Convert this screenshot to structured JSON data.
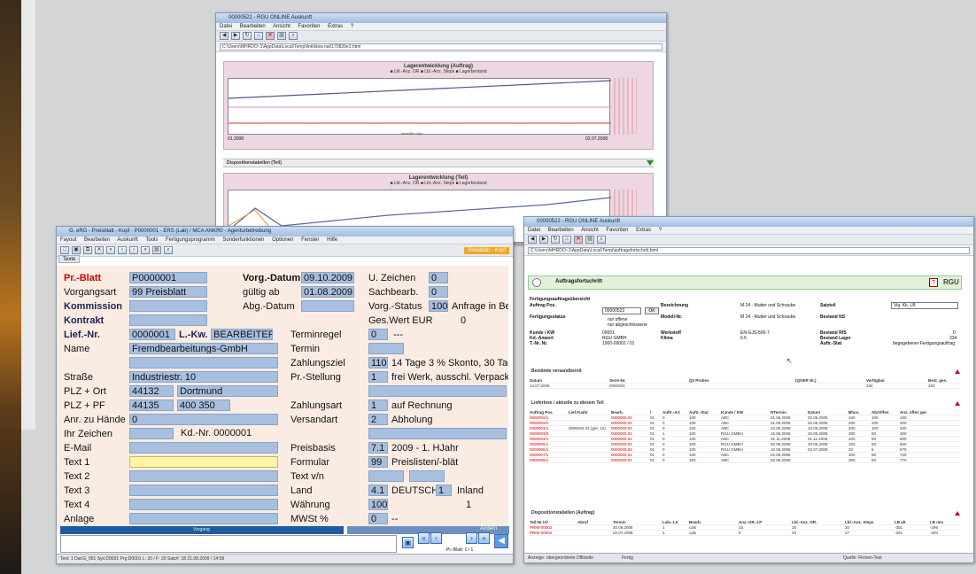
{
  "win1": {
    "title": "00000522 - RGU ONLINE Auskunft",
    "menu": [
      "Datei",
      "Bearbeiten",
      "Ansicht",
      "Favoriten",
      "Extras",
      "?"
    ],
    "address": "C:\\Users\\MHRDO~1\\AppData\\Local\\Temp\\link\\ktow.na0170839e2.html",
    "chart1": {
      "title": "Lagerentwicklung (Auftrag)",
      "legend": "■ Lbl.-Anz. OR   ■ Lbl.-Anz. Steps   ■ Lagerbestand",
      "x_start": "01.2008",
      "x_end": "02.07.2008",
      "x_mid": "erstelllt+ clips"
    },
    "section": "Dispositionstabellen (Teil)",
    "chart2": {
      "title": "Lagerentwicklung (Teil)",
      "legend": "■ Lbl.-Anz. OR   ■ Lbl.-Anz. Steps   ■ Lagerbestand"
    }
  },
  "win3": {
    "title": "G. eRG - Preisblatt - Kopf - P0000001 - ERS (Lab) / MCA ANKR0 - Agenturbetreibung",
    "menu": [
      "Fayout",
      "Bearbeiten",
      "Auskunft",
      "Tools",
      "Fertigungsprogramm",
      "Sonderfunktionen",
      "Optionen",
      "Fenster",
      "Hilfe"
    ],
    "top_right": "Preisblatt - Kopf",
    "tab": "Texte",
    "fields": {
      "pr_blatt_label": "Pr.-Blatt",
      "pr_blatt": "P0000001",
      "vorgangsart_label": "Vorgangsart",
      "vorgangsart_num": "99",
      "vorgangsart": "Preisblatt",
      "kommission_label": "Kommission",
      "kontrakt_label": "Kontrakt",
      "lief_nr_label": "Lief.-Nr.",
      "lief_nr": "0000001",
      "lkw_label": "L.-Kw.",
      "lkw": "BEARBEITER",
      "name_label": "Name",
      "name": "Fremdbearbeitungs-GmbH",
      "strasse_label": "Straße",
      "strasse": "Industriestr. 10",
      "plz_ort_label": "PLZ + Ort",
      "plz": "44132",
      "ort": "Dortmund",
      "plz_pf_label": "PLZ + PF",
      "plz_pf": "44135",
      "pf": "400 350",
      "anr_label": "Anr. zu Hände",
      "anr": "0",
      "ihr_zeichen_label": "Ihr Zeichen",
      "kd_nr": "Kd.-Nr. 0000001",
      "email_label": "E-Mail",
      "text1_label": "Text 1",
      "text2_label": "Text 2",
      "text3_label": "Text 3",
      "text4_label": "Text 4",
      "anlage_label": "Anlage",
      "vorg_datum_label": "Vorg.-Datum",
      "vorg_datum": "09.10.2009",
      "gueltig_label": "gültig ab",
      "gueltig": "01.08.2009",
      "abg_datum_label": "Abg.-Datum",
      "u_zeichen_label": "U. Zeichen",
      "u_zeichen": "0",
      "sachbearb_label": "Sachbearb.",
      "sachbearb": "0",
      "vorg_status_label": "Vorg.-Status",
      "vorg_status": "100",
      "vorg_status_text": "Anfrage in Bea",
      "ges_wert_label": "Ges.Wert EUR",
      "ges_wert": "0",
      "terminregel_label": "Terminregel",
      "terminregel": "0",
      "terminregel_text": "---",
      "termin_label": "Termin",
      "zahlungsziel_label": "Zahlungsziel",
      "zahlungsziel": "110",
      "zahlungsziel_text": "14 Tage 3 % Skonto, 30 Tage",
      "pr_stellung_label": "Pr.-Stellung",
      "pr_stellung": "1",
      "pr_stellung_text": "frei Werk, ausschl. Verpackung",
      "zahlungsart_label": "Zahlungsart",
      "zahlungsart": "1",
      "zahlungsart_text": "auf Rechnung",
      "versandart_label": "Versandart",
      "versandart": "2",
      "versandart_text": "Abholung",
      "preisbasis_label": "Preisbasis",
      "preisbasis": "7.1",
      "preisbasis_text": "2009 - 1. HJahr",
      "formular_label": "Formular",
      "formular": "99",
      "formular_text": "Preislisten/-blät",
      "text_vn_label": "Text v/n",
      "land_label": "Land",
      "land": "4.1",
      "land_text": "DEUTSCH",
      "land_num": "1",
      "land_text2": "Inland",
      "waehrung_label": "Währung",
      "waehrung": "100",
      "waehrung_num": "1",
      "mwst_label": "MWSt %",
      "mwst": "0",
      "mwst_text": "--"
    },
    "bottom_tab_left": "Vorgang",
    "bottom_tab_right": "Ändern",
    "pr_blatt_counter": "Pr.-Blatt: 1 / 1",
    "status": "Text: 1   Dat:G_001   Sys:D0001   Prg:D0001   L: 20 / F: 20   Satz#: 18   21.08.2009 / 14:58"
  },
  "win4": {
    "title": "00000522 - RGU ONLINE Auskunft",
    "menu": [
      "Datei",
      "Bearbeiten",
      "Ansicht",
      "Favoriten",
      "Extras",
      "?"
    ],
    "address": "C:\\Users\\MHRDO~1\\AppData\\Local\\Temp\\auftragsfortschritt.html",
    "header": "Auftragsfortschritt",
    "logo": "RGU",
    "form": {
      "title": "Fertigungsauftragsübersicht",
      "auftrag_pos_label": "Auftrag Pos.",
      "fertigungsstatus_label": "Fertigungsstatus",
      "auftrag_value": "00000522",
      "ok": "OK",
      "nur_offene": "nur offene",
      "nur_abgeschlossene": "nur abgeschlossene",
      "bezeichnung_label": "Bezeichnung",
      "bezeichnung": "M 24 - Mutter und Schraube",
      "modell_label": "Modell-Nr.",
      "modell": "M 24 - Mutter und Schraube",
      "satzteil_label": "Satzteil",
      "satzteil_value": "Vig. Kk. LB",
      "bestand_label": "Bestand NS",
      "kunde_label": "Kunde / KW",
      "kunde": "00001",
      "kd_anwort_label": "Kd.-Anwort",
      "kd_anwort": "RGU GMBH",
      "lt_nr_label": "T.-Nr. Nr.",
      "lt_nr": "1000-00002 / 01",
      "werkstoff_label": "Werkstoff",
      "werkstoff": "EN-GJS-500-7",
      "klima_label": "Klima",
      "klima": "6.5",
      "bestand_rs_label": "Bestand RfS",
      "bestand_rs": "0",
      "bestand_lager_label": "Bestand Lager",
      "bestand_lager": "334",
      "auftr_stat_label": "Auftr.-Stat",
      "auftr_stat": "begegebener Fertigungsauftrag"
    },
    "detail_title": "Bestände versandbereit",
    "detail_headers": [
      "Datum",
      "Serie-Nr.",
      "Q3 Probes",
      "(QGER Nr.)",
      "Verfügbar",
      "Best. ges."
    ],
    "detail_row": [
      "14.07.2008",
      "0000003",
      "",
      "",
      "334",
      "334"
    ],
    "lieferlose_title": "Lieferlose / aktuelle zu diesem Teil",
    "lieferlose_headers": [
      "Auftrag Pos.",
      "Lief.Fuahr",
      "Bearb.",
      "/",
      "Auftr.-Art",
      "Auftr.-Stat",
      "Kunde / KW",
      "NTermin",
      "Datum",
      "Bhcs.",
      "AbrOffen",
      "Anz. offen ges."
    ],
    "lieferlose_rows": [
      [
        "0000002/1",
        "",
        "0000000.02",
        "01",
        "0",
        "100",
        "ABC",
        "01.06.2008",
        "02.06.2008",
        "100",
        "100",
        "100"
      ],
      [
        "0000002/2",
        "",
        "0000000.03",
        "01",
        "0",
        "100",
        "ABC",
        "01.06.2008",
        "02.06.2008",
        "200",
        "200",
        "300"
      ],
      [
        "0000003/1",
        "0000004.01 (ger. 10)",
        "0000000.04",
        "01",
        "0",
        "100",
        "ABC",
        "10.06.2008",
        "10.06.2008",
        "400",
        "100",
        "400"
      ],
      [
        "0000003/2",
        "",
        "0000000.01",
        "01",
        "1",
        "100",
        "RGU GMBH",
        "15.06.2008",
        "15.06.2008",
        "300",
        "50",
        "400"
      ],
      [
        "0000004/1",
        "",
        "0000000.04",
        "01",
        "0",
        "100",
        "ABC",
        "01.11.2008",
        "01.11.2008",
        "400",
        "50",
        "800"
      ],
      [
        "0000005/1",
        "",
        "0000000.02",
        "01",
        "0",
        "100",
        "RGU GMBH",
        "20.06.2008",
        "20.06.2008",
        "100",
        "50",
        "650"
      ],
      [
        "0000006/1",
        "",
        "0000000.03",
        "01",
        "0",
        "100",
        "RGU GMBH",
        "10.06.2008",
        "02.07.2008",
        "20",
        "5",
        "670"
      ],
      [
        "0000007/1",
        "",
        "0000000.01",
        "01",
        "0",
        "100",
        "ABC",
        "02.06.2008",
        "",
        "300",
        "50",
        "720"
      ],
      [
        "0000008/1",
        "",
        "0000000.01",
        "01",
        "0",
        "100",
        "ABC",
        "02.06.2008",
        "",
        "300",
        "50",
        "770"
      ]
    ],
    "dispo_title": "Dispositionstabellen (Auftrag)",
    "dispo_headers": [
      "Teil-Nr./Al",
      "Abruf",
      "Termin",
      "Lals.-LS",
      "Bearb.",
      "Anz.-OR.-LP",
      "Lbl.-Anz. OR.",
      "Lbl.-Anz. Steps",
      "LB alt",
      "LB neu"
    ],
    "dispo_rows": [
      [
        "PRIM-00002",
        "",
        "30.06.2008",
        "1",
        "cals",
        "15",
        "15",
        "20",
        "-301",
        "-296"
      ],
      [
        "PRIM-00002",
        "",
        "02.07.2008",
        "1",
        "cals",
        "5",
        "20",
        "27",
        "-301",
        "-294"
      ]
    ],
    "status_left": "Anzeige: übergeordnete Offizielle",
    "status_mid": "Fertig",
    "status_right": "Quelle: Firmen-Test"
  },
  "colors": {
    "form_bg": "#faece3",
    "field": "#a8c0df",
    "label_red": "#cc0000",
    "chart_bg": "#ecd7e2",
    "header_green": "#e2f1da"
  }
}
